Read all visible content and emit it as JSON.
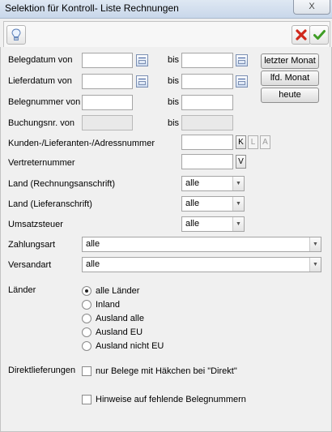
{
  "window": {
    "title": "Selektion für Kontroll- Liste Rechnungen",
    "close_label": "X"
  },
  "toolbar": {
    "hint_icon": "lightbulb-icon",
    "cancel_icon": "red-x-icon",
    "ok_icon": "green-check-icon"
  },
  "fields": {
    "belegdatum_von": "Belegdatum von",
    "lieferdatum_von": "Lieferdatum von",
    "belegnummer_von": "Belegnummer von",
    "buchungsnr_von": "Buchungsnr. von",
    "bis": "bis",
    "kunden": "Kunden-/Lieferanten-/Adressnummer",
    "vertreter": "Vertreternummer",
    "land_rechnung": "Land (Rechnungsanschrift)",
    "land_liefer": "Land (Lieferanschrift)",
    "umsatzsteuer": "Umsatzsteuer",
    "zahlungsart": "Zahlungsart",
    "versandart": "Versandart"
  },
  "buttons": {
    "letzter_monat": "letzter Monat",
    "lfd_monat": "lfd. Monat",
    "heute": "heute",
    "k": "K",
    "l": "L",
    "a": "A",
    "v": "V"
  },
  "selects": {
    "land_rechnung": "alle",
    "land_liefer": "alle",
    "umsatzsteuer": "alle",
    "zahlungsart": "alle",
    "versandart": "alle"
  },
  "laender": {
    "label": "Länder",
    "options": [
      "alle Länder",
      "Inland",
      "Ausland alle",
      "Ausland EU",
      "Ausland nicht EU"
    ],
    "selected": "alle Länder"
  },
  "direkt": {
    "label": "Direktlieferungen",
    "checkbox": "nur Belege mit Häkchen bei \"Direkt\""
  },
  "hinweise": {
    "checkbox": "Hinweise auf fehlende Belegnummern"
  }
}
